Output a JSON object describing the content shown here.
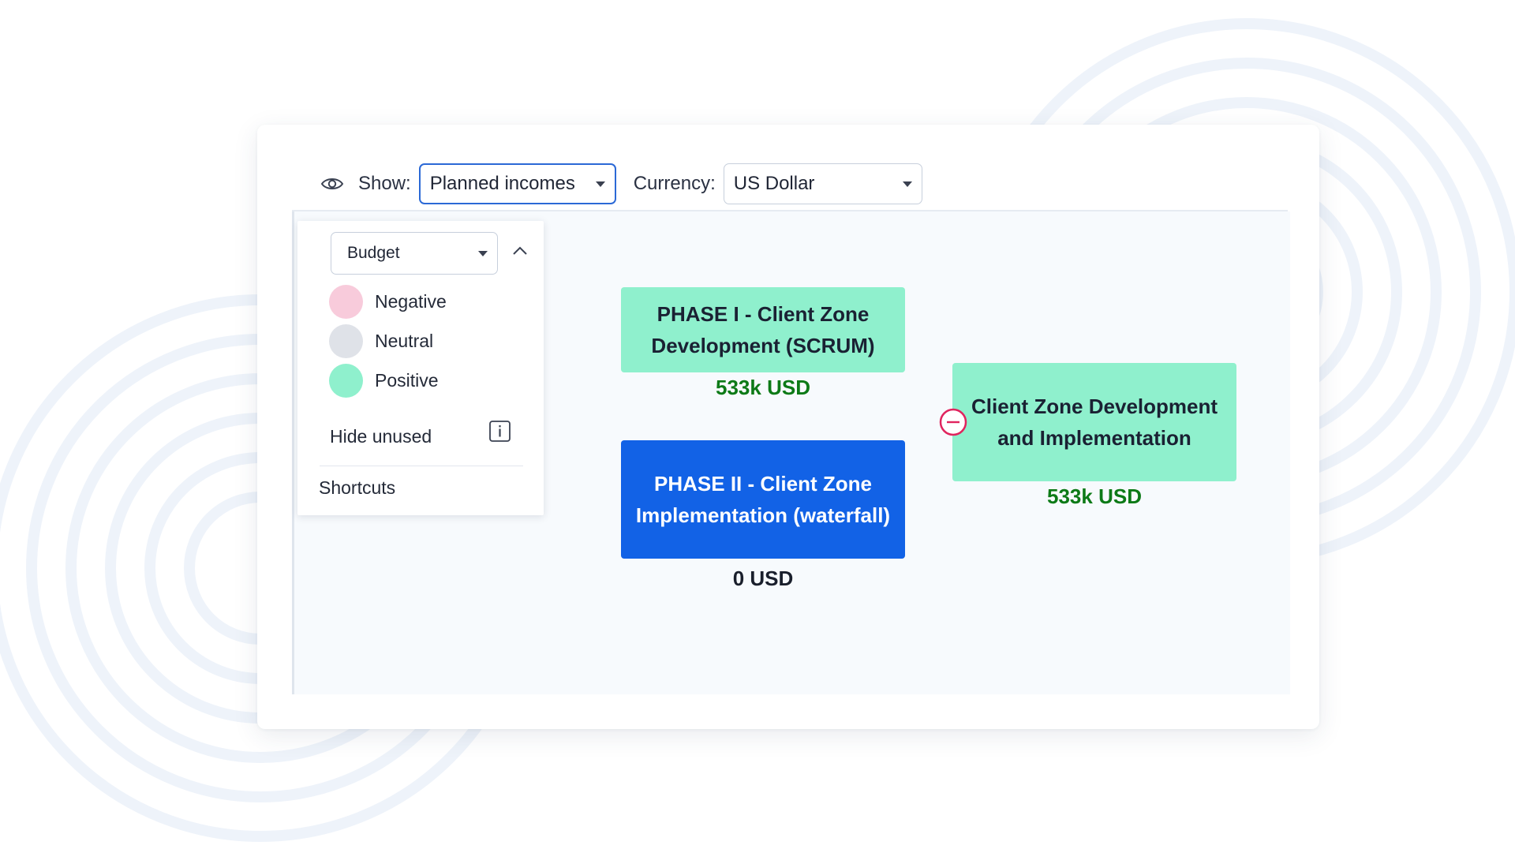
{
  "toolbar": {
    "show_label": "Show:",
    "show_value": "Planned incomes",
    "currency_label": "Currency:",
    "currency_value": "US Dollar"
  },
  "legend": {
    "budget_value": "Budget",
    "items": [
      {
        "label": "Negative",
        "color": "#f8cbdb"
      },
      {
        "label": "Neutral",
        "color": "#dfe2e8"
      },
      {
        "label": "Positive",
        "color": "#8ff0cd"
      }
    ],
    "hide_unused_label": "Hide unused",
    "shortcuts_label": "Shortcuts"
  },
  "nodes": {
    "phase1": {
      "title": "PHASE I - Client Zone Development (SCRUM)",
      "amount": "533k USD"
    },
    "phase2": {
      "title": "PHASE II - Client Zone Implementation (waterfall)",
      "amount": "0 USD"
    },
    "root": {
      "title": "Client Zone Development and Implementation",
      "amount": "533k USD"
    }
  },
  "colors": {
    "accent_blue": "#1262e6",
    "positive_green": "#8ff0cd",
    "amount_green": "#0d7a17",
    "collapse_red": "#e0245e"
  }
}
